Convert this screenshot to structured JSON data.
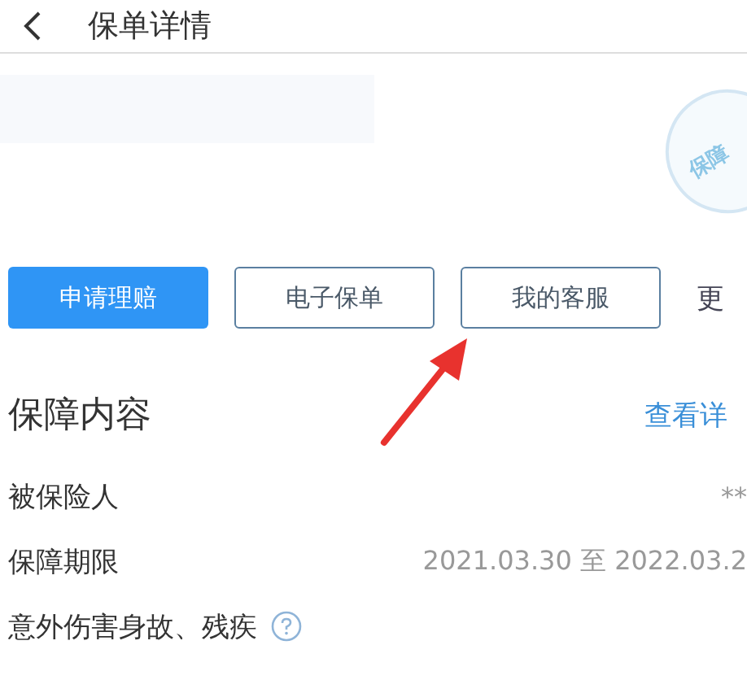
{
  "header": {
    "title": "保单详情"
  },
  "stamp": {
    "text": "保障"
  },
  "actions": [
    {
      "label": "申请理赔",
      "kind": "primary"
    },
    {
      "label": "电子保单",
      "kind": "outline"
    },
    {
      "label": "我的客服",
      "kind": "outline"
    },
    {
      "label": "更",
      "kind": "link"
    }
  ],
  "section": {
    "title": "保障内容",
    "link": "查看详"
  },
  "rows": [
    {
      "label": "被保险人",
      "value": "**",
      "help": false
    },
    {
      "label": "保障期限",
      "value": "2021.03.30 至 2022.03.2",
      "help": false
    },
    {
      "label": "意外伤害身故、残疾",
      "help": true
    }
  ]
}
